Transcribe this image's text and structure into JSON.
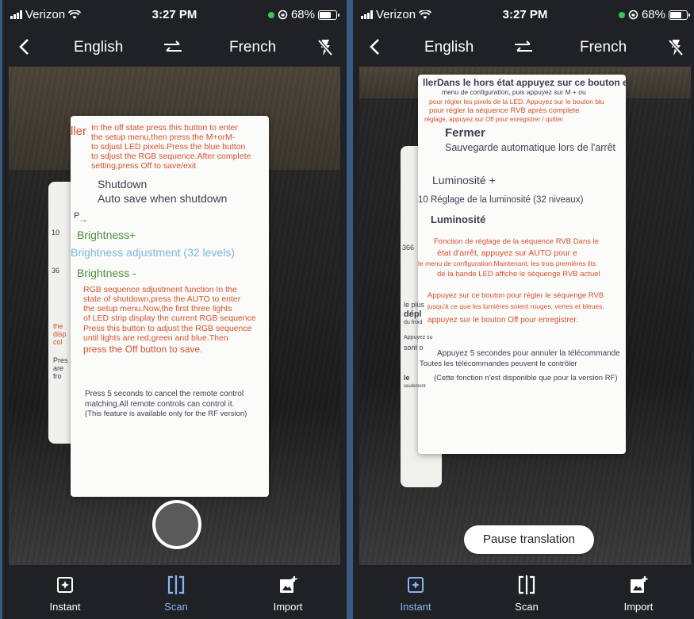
{
  "status": {
    "carrier": "Verizon",
    "time": "3:27 PM",
    "battery": "68%",
    "battery_level": 0.68
  },
  "header": {
    "source_lang": "English",
    "target_lang": "French"
  },
  "left": {
    "nav": {
      "instant": "Instant",
      "scan": "Scan",
      "import": "Import",
      "active": "scan"
    },
    "doc": {
      "header": "ller",
      "p1": [
        "In the off state press this button to enter",
        "the setup menu,then press the M+orM-",
        "to sdjust LED pixels.Press the blue button",
        "to sdjust the RGB sequence.After complete",
        "setting,press Off to save/exit"
      ],
      "shutdown": "Shutdown",
      "autosave": "Auto save when shutdown",
      "left_p": "P",
      "left_10": "10",
      "brightness_plus": "Brightness+",
      "brightness_adj": "Brightness adjustment (32 levels)",
      "left_36": "36",
      "brightness_minus": "Brightness -",
      "p2": [
        "RGB sequence sdjustment function In the",
        "state of shutdown,press the AUTO to enter",
        "the setup menu.Now,the first three lights",
        "of LED strip display the current RGB sequence",
        "Press this button to adjust the RGB sequence",
        "until lights are red,green and blue.Then",
        "press the Off button to save."
      ],
      "left_frag": [
        "the",
        "disp",
        "col",
        "Pres",
        "are",
        "fro"
      ],
      "p3": [
        "Press 5 seconds to cancel the remote control",
        "matching.All remote controls can control it.",
        "(This feature is available only for the RF version)"
      ]
    }
  },
  "right": {
    "nav": {
      "instant": "Instant",
      "scan": "Scan",
      "import": "Import",
      "active": "instant"
    },
    "pause_label": "Pause translation",
    "doc": {
      "p1": [
        "llerDans le hors état appuyez sur ce bouton entrer",
        "menu de configuration, puis appuyez sur M + ou",
        "pour régler les pixels de la LED. Appuyez sur le bouton blu",
        "pour régler la séquence RVB après complete",
        "réglage, appuyez sur Off pour enregistrer / quitter"
      ],
      "fermer": "Fermer",
      "sauvegarde": "Sauvegarde automatique lors de l'arrêt",
      "lum_plus": "Luminosité +",
      "reglage": "10 Réglage de la luminosité (32 niveaux)",
      "lum": "Luminosité",
      "left_366": "366",
      "p2": [
        "Fonction de réglage de la séquence RVB Dans le",
        "état d'arrêt, appuyez sur AUTO pour e",
        "le menu de configuration.Maintenant, les trois premières lits",
        "de la bande LED affiche le séquenge RVB actuel"
      ],
      "left_frag": [
        "le plus",
        "dépl",
        "du froid",
        "Appuyez su",
        "sont o",
        "une correspondance",
        "le",
        "seulement"
      ],
      "p3": [
        "Appuyez sur ce bouton pour régler le séquenge RVB",
        "jusqu'à ce que les lumières soient rouges, vertes et bleues,",
        "appuyez sur le bouton Off pour enregistrer."
      ],
      "p4": [
        "Appuyez 5 secondes pour annuler la télécommande",
        "Toutes les télécommandes peuvent le contrôler",
        "(Cette fonction n'est disponible que pour la version RF)"
      ]
    }
  }
}
